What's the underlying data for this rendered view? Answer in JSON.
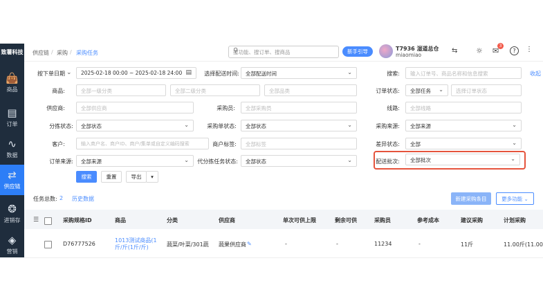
{
  "brand": "致薯科技",
  "nav": [
    {
      "label": "商品",
      "icon": "bag-icon"
    },
    {
      "label": "订单",
      "icon": "order-icon"
    },
    {
      "label": "数据",
      "icon": "chart-icon"
    },
    {
      "label": "供应链",
      "icon": "supply-chain-icon"
    },
    {
      "label": "进销存",
      "icon": "inventory-icon"
    },
    {
      "label": "营销",
      "icon": "marketing-icon"
    }
  ],
  "breadcrumb": [
    "供应链",
    "采购",
    "采购任务"
  ],
  "search": {
    "placeholder": "搜功能、搜订单、搜商品"
  },
  "guide_label": "新手引导",
  "user": {
    "name": "T7936 湿道总仓",
    "sub": "miaomiao"
  },
  "notif_badge": "3",
  "filters": {
    "order_date_label": "按下单日期",
    "date_range": "2025-02-18 00:00 ~ 2025-02-18 24:00",
    "delivery_time_label": "选择配送时间:",
    "delivery_time_value": "全部配送时间",
    "search_label": "搜索:",
    "search_placeholder": "输入订单号、商品名称和信息搜索",
    "collapse_label": "收起",
    "goods_label": "商品:",
    "cat1": "全部一级分类",
    "cat2": "全部二级分类",
    "goods_ph": "全部品类",
    "order_status_label": "订单状态:",
    "order_status_value": "全部任务",
    "order_status_ph": "选择订单状态",
    "supplier_label": "供应商:",
    "supplier_ph": "全部供应商",
    "buyer_label": "采购员:",
    "buyer_ph": "全部采购员",
    "route_label": "线路:",
    "route_ph": "全部线路",
    "split_label": "分拣状态:",
    "split_value": "全部状态",
    "purchase_order_label": "采购单状态:",
    "purchase_order_value": "全部状态",
    "source_label": "采购来源:",
    "source_value": "全部来源",
    "customer_label": "客户:",
    "customer_ph": "输入商户名、商户ID、商户/集单或自定义编码搜索",
    "tag_label": "商户标签:",
    "tag_ph": "全部标签",
    "diff_label": "差异状态:",
    "diff_value": "全部",
    "order_source_label": "订单来源:",
    "order_source_value": "全部来源",
    "agent_label": "代分拣任务状态:",
    "agent_value": "全部状态",
    "batch_label": "配送批次:",
    "batch_value": "全部批次"
  },
  "actions": {
    "search": "搜索",
    "reset": "重置",
    "export": "导出"
  },
  "summary": {
    "label": "任务总数:",
    "count": "2",
    "history": "历史数据"
  },
  "toolbar": {
    "new_purchase": "新建采购条目",
    "more": "更多功能"
  },
  "table": {
    "headers": [
      "采购规格ID",
      "商品",
      "分类",
      "供应商",
      "单次可供上限",
      "剩余可供",
      "采购员",
      "参考成本",
      "建议采购",
      "计划采购"
    ],
    "rows": [
      {
        "id": "D76777526",
        "goods": "1013测试商品(1斤/斤(1斤/斤)",
        "category": "蔬菜/叶菜/301蔬",
        "supplier": "蔬果供应商",
        "limit": "-",
        "remain": "-",
        "buyer": "11234",
        "cost": "-",
        "suggest": "11斤",
        "plan": "11.00斤(11.00斤"
      }
    ]
  }
}
